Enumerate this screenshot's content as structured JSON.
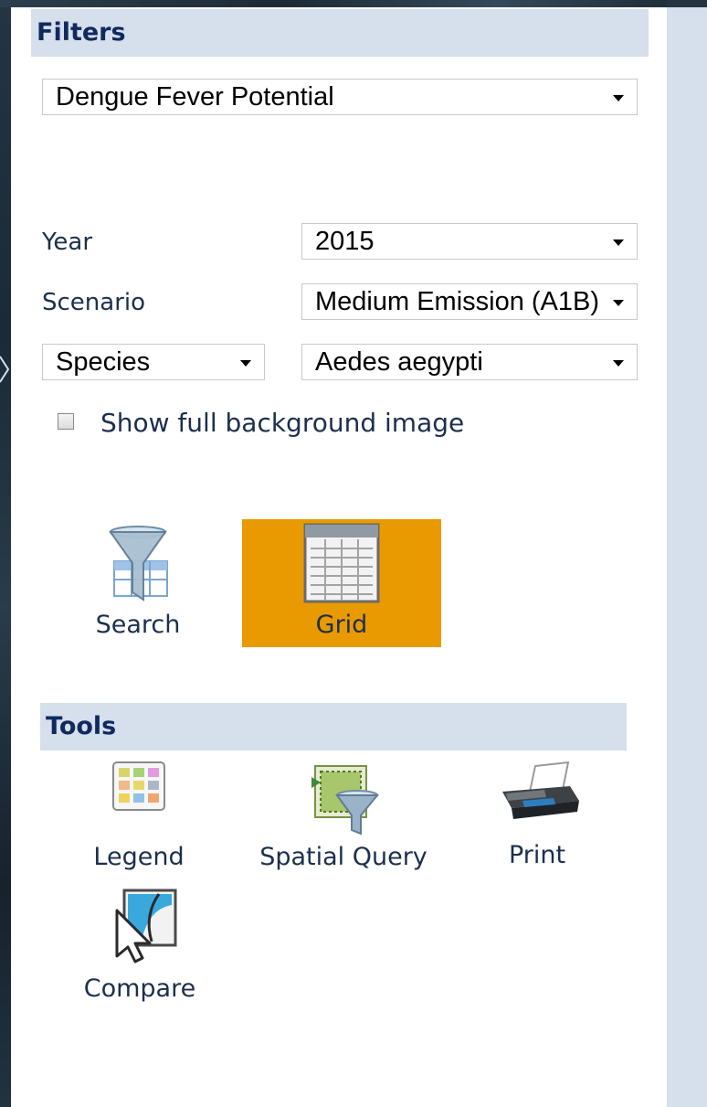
{
  "filters": {
    "header": "Filters",
    "layer_select": {
      "value": "Dengue Fever Potential"
    },
    "year": {
      "label": "Year",
      "value": "2015"
    },
    "scenario": {
      "label": "Scenario",
      "value": "Medium Emission (A1B)"
    },
    "species_type": {
      "value": "Species"
    },
    "species": {
      "value": "Aedes aegypti"
    },
    "show_background": {
      "label": "Show full background image",
      "checked": false
    }
  },
  "view_buttons": {
    "search": {
      "label": "Search",
      "icon": "funnel-table-icon"
    },
    "grid": {
      "label": "Grid",
      "icon": "grid-table-icon",
      "active": true,
      "active_color": "#e89a00"
    }
  },
  "tools": {
    "header": "Tools",
    "items": [
      {
        "label": "Legend",
        "icon": "legend-icon"
      },
      {
        "label": "Spatial Query",
        "icon": "spatial-query-icon"
      },
      {
        "label": "Print",
        "icon": "printer-icon"
      },
      {
        "label": "Compare",
        "icon": "compare-icon"
      }
    ]
  },
  "colors": {
    "header_bg": "#d6dfec",
    "header_text": "#102a5e",
    "accent": "#e89a00"
  }
}
